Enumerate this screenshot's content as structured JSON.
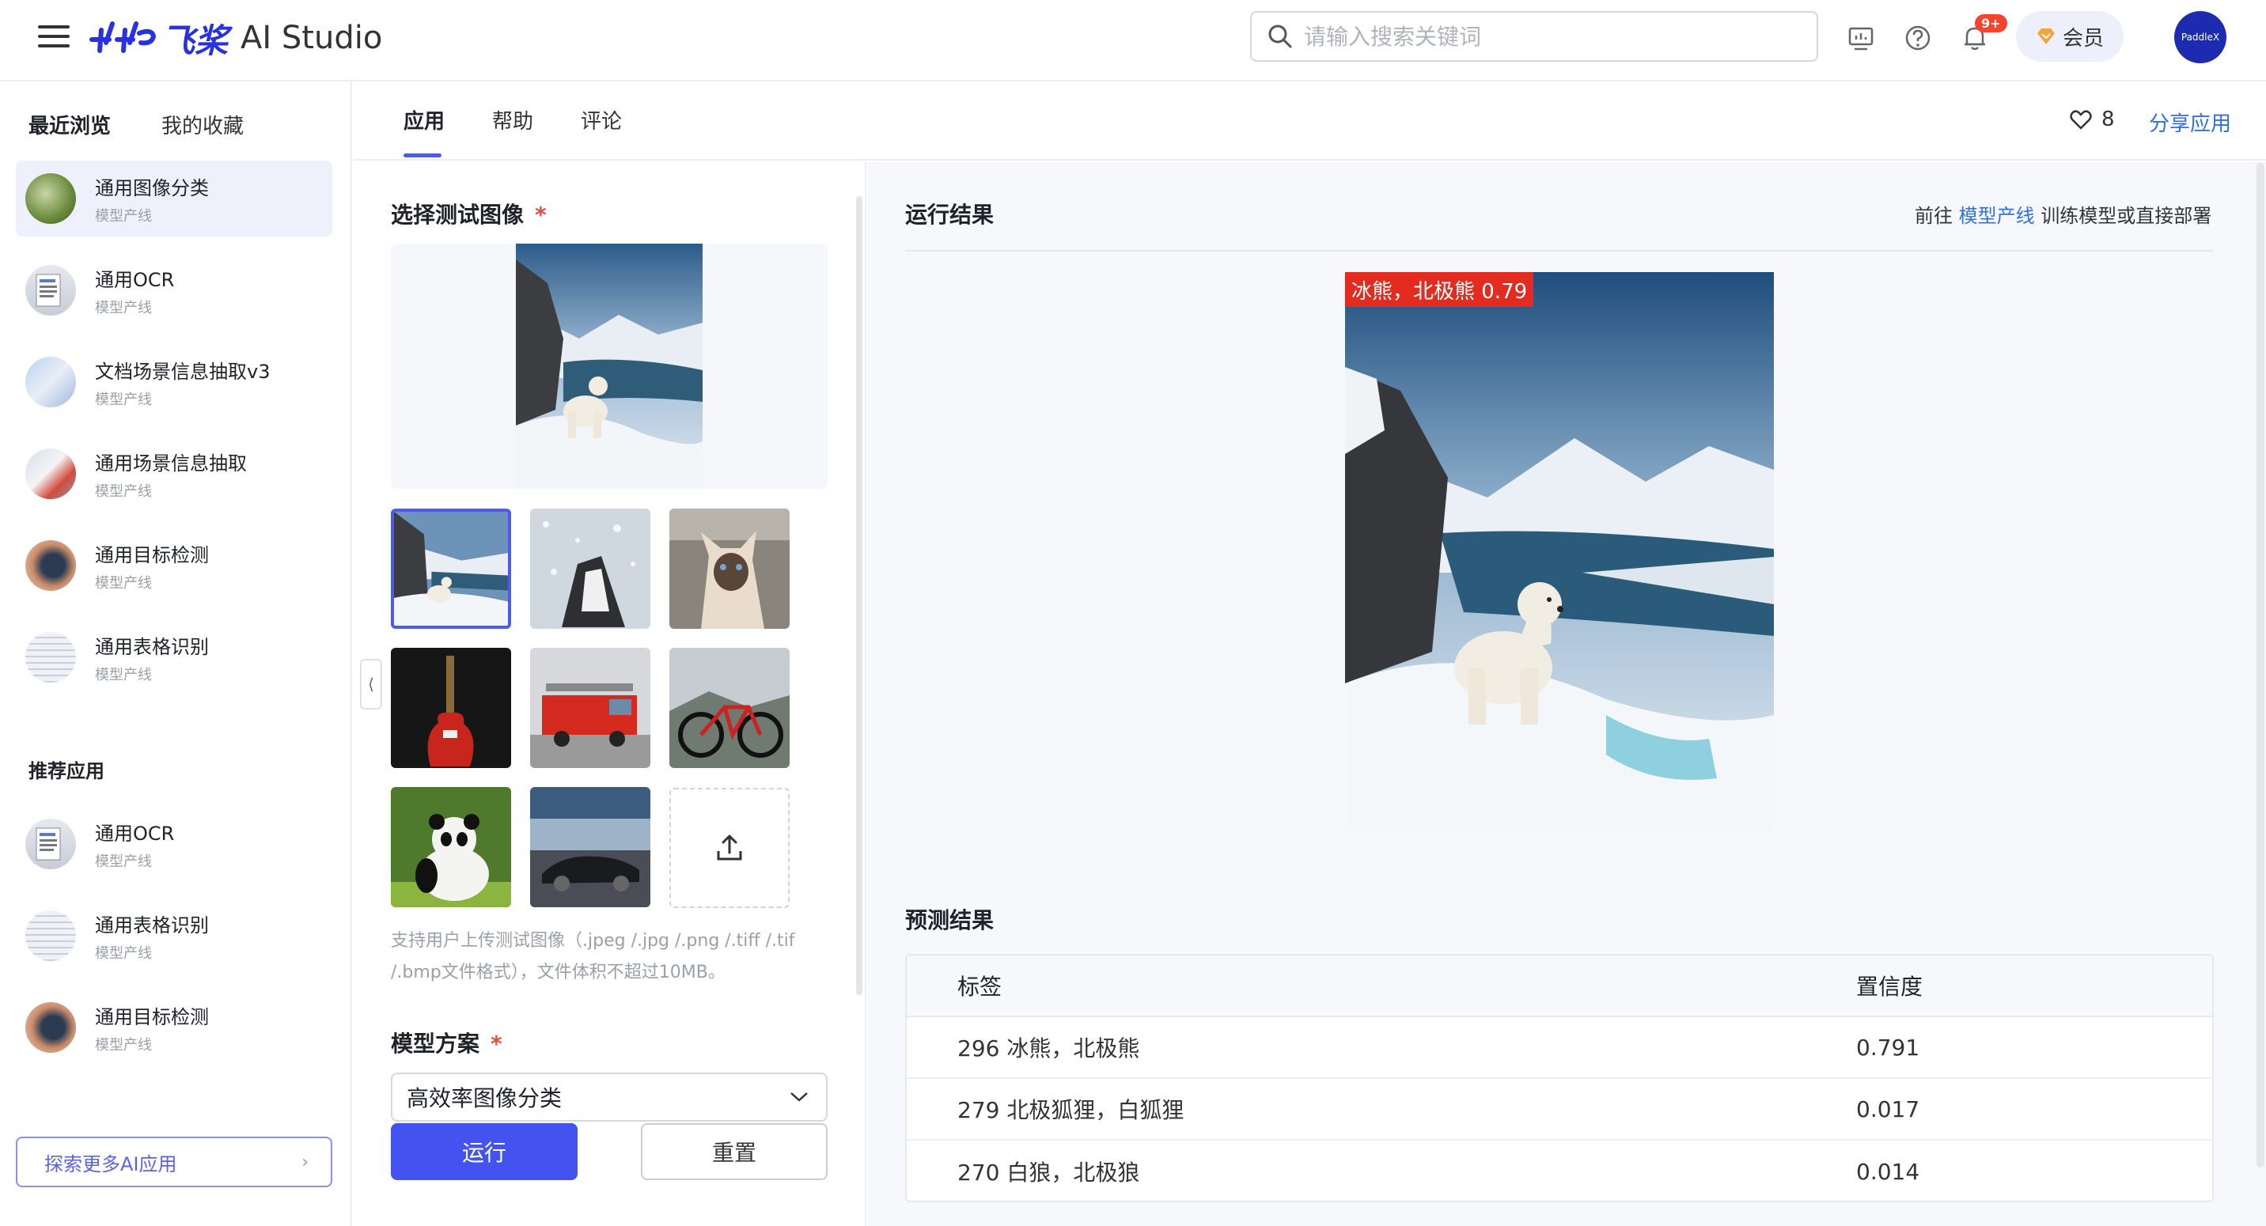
{
  "header": {
    "logo_cn": "飞桨",
    "logo_en": "AI Studio",
    "search_placeholder": "请输入搜索关键词",
    "notification_badge": "9+",
    "vip_label": "会员",
    "avatar_text": "PaddleX"
  },
  "sidebar": {
    "tabs": [
      "最近浏览",
      "我的收藏"
    ],
    "recent": [
      {
        "title": "通用图像分类",
        "sub": "模型产线"
      },
      {
        "title": "通用OCR",
        "sub": "模型产线"
      },
      {
        "title": "文档场景信息抽取v3",
        "sub": "模型产线"
      },
      {
        "title": "通用场景信息抽取",
        "sub": "模型产线"
      },
      {
        "title": "通用目标检测",
        "sub": "模型产线"
      },
      {
        "title": "通用表格识别",
        "sub": "模型产线"
      }
    ],
    "recommend_title": "推荐应用",
    "recommend": [
      {
        "title": "通用OCR",
        "sub": "模型产线"
      },
      {
        "title": "通用表格识别",
        "sub": "模型产线"
      },
      {
        "title": "通用目标检测",
        "sub": "模型产线"
      }
    ],
    "explore_label": "探索更多AI应用"
  },
  "main_tabs": [
    "应用",
    "帮助",
    "评论"
  ],
  "like_count": "8",
  "share_label": "分享应用",
  "left": {
    "select_image_title": "选择测试图像",
    "required_mark": "*",
    "upload_hint": "支持用户上传测试图像（.jpeg /.jpg /.png /.tiff /.tif /.bmp文件格式），文件体积不超过10MB。",
    "model_title": "模型方案",
    "model_selected": "高效率图像分类",
    "run_label": "运行",
    "reset_label": "重置"
  },
  "right": {
    "result_title": "运行结果",
    "goto_prefix": "前往",
    "goto_link": "模型产线",
    "goto_suffix": "训练模型或直接部署",
    "overlay_label": "冰熊，北极熊 0.79",
    "predict_title": "预测结果",
    "table_headers": [
      "标签",
      "置信度"
    ],
    "rows": [
      {
        "label": "296 冰熊，北极熊",
        "score": "0.791"
      },
      {
        "label": "279 北极狐狸，白狐狸",
        "score": "0.017"
      },
      {
        "label": "270 白狼，北极狼",
        "score": "0.014"
      }
    ]
  },
  "colors": {
    "accent": "#4452f0",
    "link": "#2f6fe8",
    "tag": "#e32b1f"
  }
}
